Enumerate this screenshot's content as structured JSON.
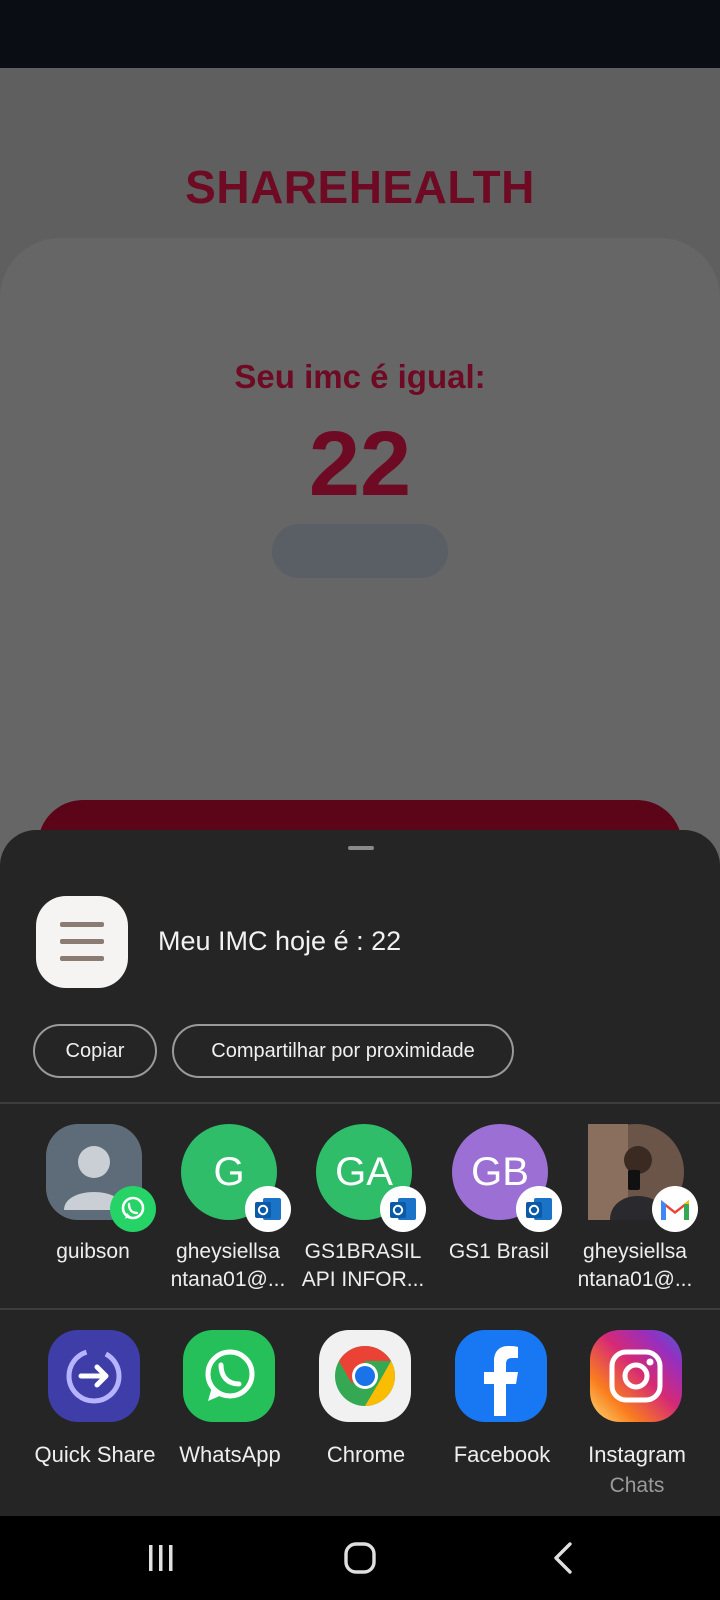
{
  "app": {
    "title": "SHAREHEALTH",
    "imc_label": "Seu imc é igual:",
    "imc_value": "22"
  },
  "share_sheet": {
    "preview_text": "Meu IMC hoje é : 22",
    "actions": {
      "copy_label": "Copiar",
      "nearby_label": "Compartilhar por proximidade"
    },
    "contacts": [
      {
        "name_line1": "guibson",
        "name_line2": "",
        "avatar_text": "",
        "badge": "whatsapp-icon"
      },
      {
        "name_line1": "gheysiellsa",
        "name_line2": "ntana01@...",
        "avatar_text": "G",
        "badge": "outlook-icon"
      },
      {
        "name_line1": "GS1BRASIL",
        "name_line2": "API INFOR...",
        "avatar_text": "GA",
        "badge": "outlook-icon"
      },
      {
        "name_line1": "GS1 Brasil",
        "name_line2": "",
        "avatar_text": "GB",
        "badge": "outlook-icon"
      },
      {
        "name_line1": "gheysiellsa",
        "name_line2": "ntana01@...",
        "avatar_text": "",
        "badge": "gmail-icon"
      }
    ],
    "apps": [
      {
        "label": "Quick Share",
        "icon": "quick-share-icon"
      },
      {
        "label": "WhatsApp",
        "icon": "whatsapp-icon"
      },
      {
        "label": "Chrome",
        "icon": "chrome-icon"
      },
      {
        "label": "Facebook",
        "icon": "facebook-icon"
      },
      {
        "label": "Instagram",
        "sublabel": "Chats",
        "icon": "instagram-icon"
      }
    ]
  },
  "colors": {
    "brand": "#6e0a24",
    "sheet_bg": "#252525",
    "contact_green": "#2fbd6a",
    "contact_purple": "#9b6fd3"
  }
}
